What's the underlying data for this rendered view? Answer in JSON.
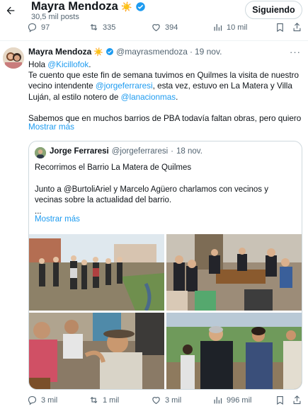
{
  "header": {
    "name": "Mayra Mendoza",
    "name_emoji": "☀️",
    "posts_count": "30,5 mil posts",
    "follow_label": "Siguiendo"
  },
  "top_actions": {
    "replies": "97",
    "reposts": "335",
    "likes": "394",
    "views": "10 mil"
  },
  "tweet": {
    "author_name": "Mayra Mendoza",
    "author_emoji": "☀️",
    "handle": "@mayrasmendoza",
    "separator": "·",
    "date": "19 nov.",
    "more": "···",
    "lines": [
      {
        "pre": "Hola ",
        "link": "@Kicillofok",
        "post": "."
      },
      {
        "pre": "Te cuento que este fin de semana tuvimos en Quilmes la visita de nuestro",
        "link": "",
        "post": ""
      },
      {
        "pre": "vecino intendente ",
        "link": "@jorgeferraresi",
        "post": ", esta vez, estuvo en La Matera y Villa"
      },
      {
        "pre": "Luján, al estilo notero de ",
        "link": "@lanacionmas",
        "post": "."
      },
      {
        "pre": "",
        "link": "",
        "post": ""
      },
      {
        "pre": "Sabemos que en muchos barrios de PBA todavía faltan obras, pero quiero",
        "link": "",
        "post": ""
      }
    ],
    "show_more": "Mostrar más"
  },
  "quote": {
    "author_name": "Jorge Ferraresi",
    "handle": "@jorgeferraresi",
    "separator": "·",
    "date": "18 nov.",
    "lines": [
      "Recorrimos el Barrio La Matera de Quilmes",
      "",
      "Junto a @BurtoliAriel y Marcelo Agüero charlamos con vecinos y",
      "vecinas sobre la actualidad del barrio.",
      "..."
    ],
    "show_more": "Mostrar más"
  },
  "bottom_actions": {
    "replies": "3 mil",
    "reposts": "1 mil",
    "likes": "3 mil",
    "views": "996 mil"
  },
  "colors": {
    "link": "#1d9bf0",
    "secondary_text": "#536471",
    "verified": "#1d9bf0",
    "border": "#cfd9de"
  },
  "icons": {
    "back": "arrow-left-icon",
    "verified": "verified-badge-icon",
    "reply": "reply-icon",
    "repost": "repost-icon",
    "like": "heart-icon",
    "views": "views-icon",
    "bookmark": "bookmark-icon",
    "share": "share-icon"
  }
}
